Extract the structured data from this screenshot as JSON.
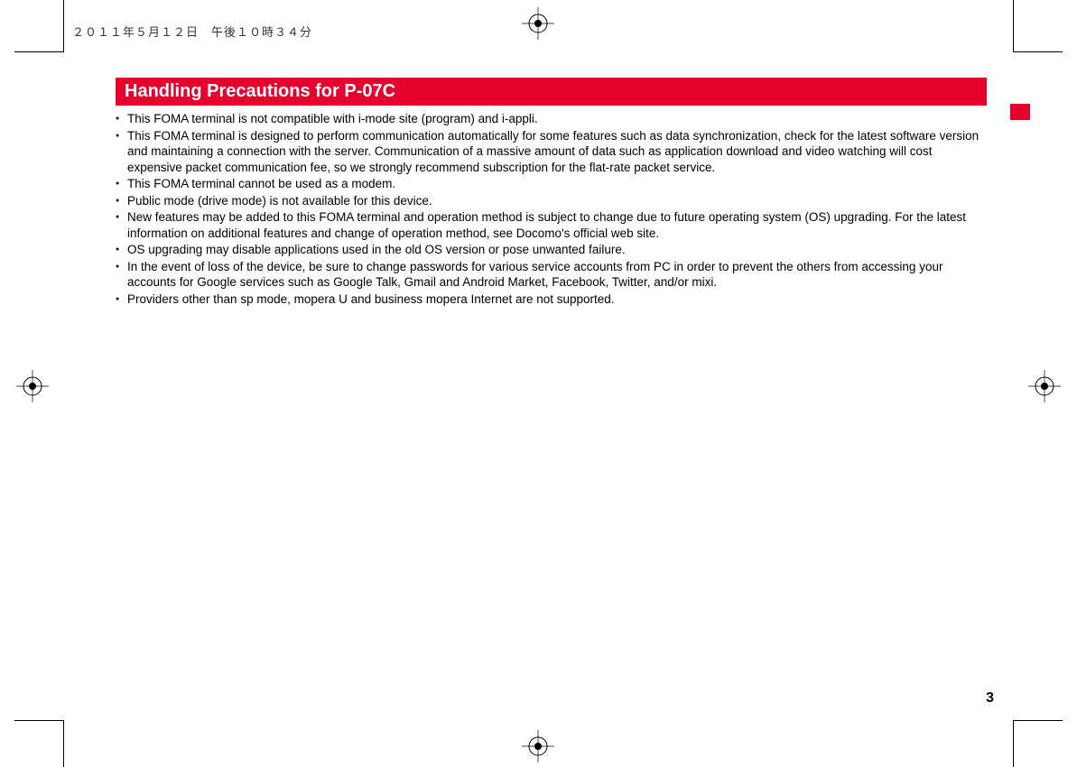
{
  "header": {
    "timestamp": "２０１１年５月１２日　午後１０時３４分"
  },
  "heading": "Handling Precautions for P-07C",
  "bullets": [
    "This FOMA terminal is not compatible with i-mode site (program) and i-appli.",
    "This FOMA terminal is designed to perform communication automatically for some features such as data synchronization, check for the latest software version and maintaining a connection with the server. Communication of a massive amount of data such as application download and video watching will cost expensive packet communication fee, so we strongly recommend subscription for the flat-rate packet service.",
    "This FOMA terminal cannot be used as a modem.",
    "Public mode (drive mode) is not available for this device.",
    "New features may be added to this FOMA terminal and operation method is subject to change due to future operating system (OS) upgrading. For the latest information on additional features and change of operation method, see Docomo's official web site.",
    "OS upgrading may disable applications used in the old OS version or pose unwanted failure.",
    "In the event of loss of the device, be sure to change passwords for various service accounts from PC in order to prevent the others from accessing your accounts for Google services such as Google Talk, Gmail and Android Market, Facebook, Twitter, and/or mixi.",
    "Providers other than sp mode, mopera U and business mopera Internet are not supported."
  ],
  "page_number": "3"
}
